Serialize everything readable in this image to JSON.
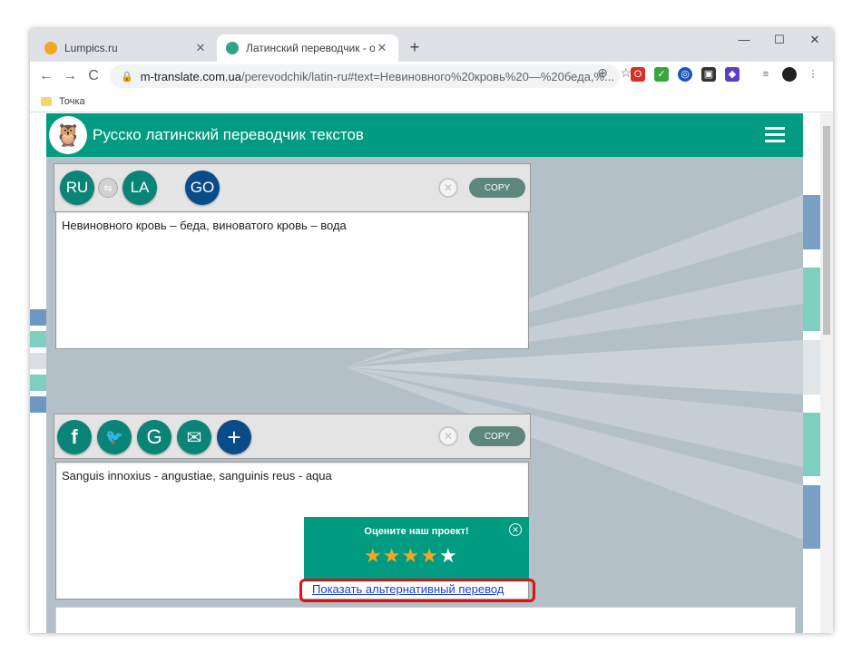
{
  "browser": {
    "tabs": [
      {
        "title": "Lumpics.ru",
        "favicon_color": "#f5a623",
        "close": "✕"
      },
      {
        "title": "Латинский переводчик - онлай",
        "favicon_color": "#2fa38a",
        "close": "✕"
      }
    ],
    "new_tab": "+",
    "window_controls": {
      "minimize": "—",
      "maximize": "☐",
      "close": "✕"
    },
    "nav": {
      "back": "←",
      "forward": "→",
      "reload": "C"
    },
    "address": {
      "host": "m-translate.com.ua",
      "rest": "/perevodchik/latin-ru#text=Невиновного%20кровь%20—%20беда,%..."
    },
    "bookmark": "Точка"
  },
  "site": {
    "title": "Русско латинский переводчик текстов",
    "accent": "#009b81",
    "input_panel": {
      "source_lang": "RU",
      "target_lang": "LA",
      "go_label": "GO",
      "swap_icon": "⇆",
      "clear_icon": "✕",
      "copy_label": "COPY"
    },
    "input_text": "Невиновного кровь – беда, виноватого кровь – вода",
    "output_panel": {
      "share": [
        {
          "name": "facebook",
          "glyph": "f",
          "color": "#0b8478"
        },
        {
          "name": "twitter",
          "glyph": "🐦",
          "color": "#0b8478"
        },
        {
          "name": "google",
          "glyph": "G",
          "color": "#0b8478"
        },
        {
          "name": "email",
          "glyph": "✉",
          "color": "#0b8478"
        },
        {
          "name": "more",
          "glyph": "+",
          "color": "#0a4c89"
        }
      ],
      "clear_icon": "✕",
      "copy_label": "COPY"
    },
    "output_text": "Sanguis innoxius - angustiae, sanguinis reus - aqua",
    "rating": {
      "prompt": "Оцените наш проект!",
      "stars_filled": 4,
      "stars_total": 5,
      "close_icon": "✕"
    },
    "alt_link": "Показать альтернативный перевод"
  }
}
